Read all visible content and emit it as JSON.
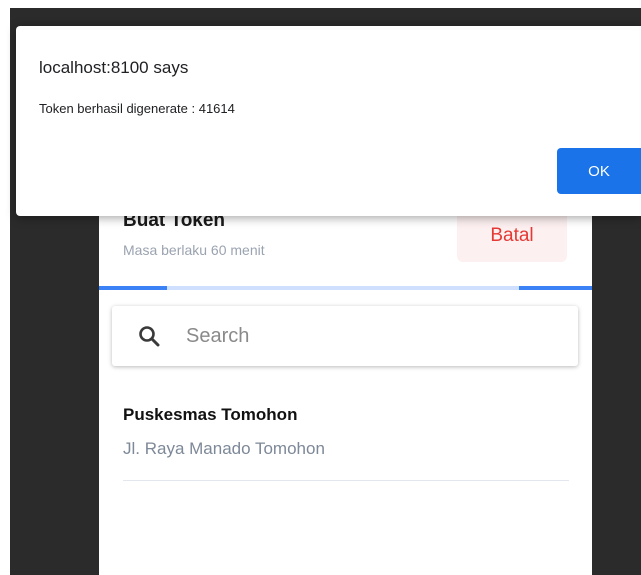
{
  "alert": {
    "title": "localhost:8100 says",
    "message": "Token berhasil digenerate : 41614",
    "ok_label": "OK",
    "button_color": "#1a73e8"
  },
  "header": {
    "title": "Buat Token",
    "subtitle": "Masa berlaku 60 menit",
    "cancel_label": "Batal",
    "cancel_color": "#e53935"
  },
  "progress": {
    "color": "#3b82f6",
    "track_color": "#cfe0ff"
  },
  "search": {
    "icon": "search-icon",
    "placeholder": "Search",
    "value": ""
  },
  "list": {
    "items": [
      {
        "name": "Puskesmas Tomohon",
        "address": "Jl. Raya Manado Tomohon"
      }
    ]
  }
}
